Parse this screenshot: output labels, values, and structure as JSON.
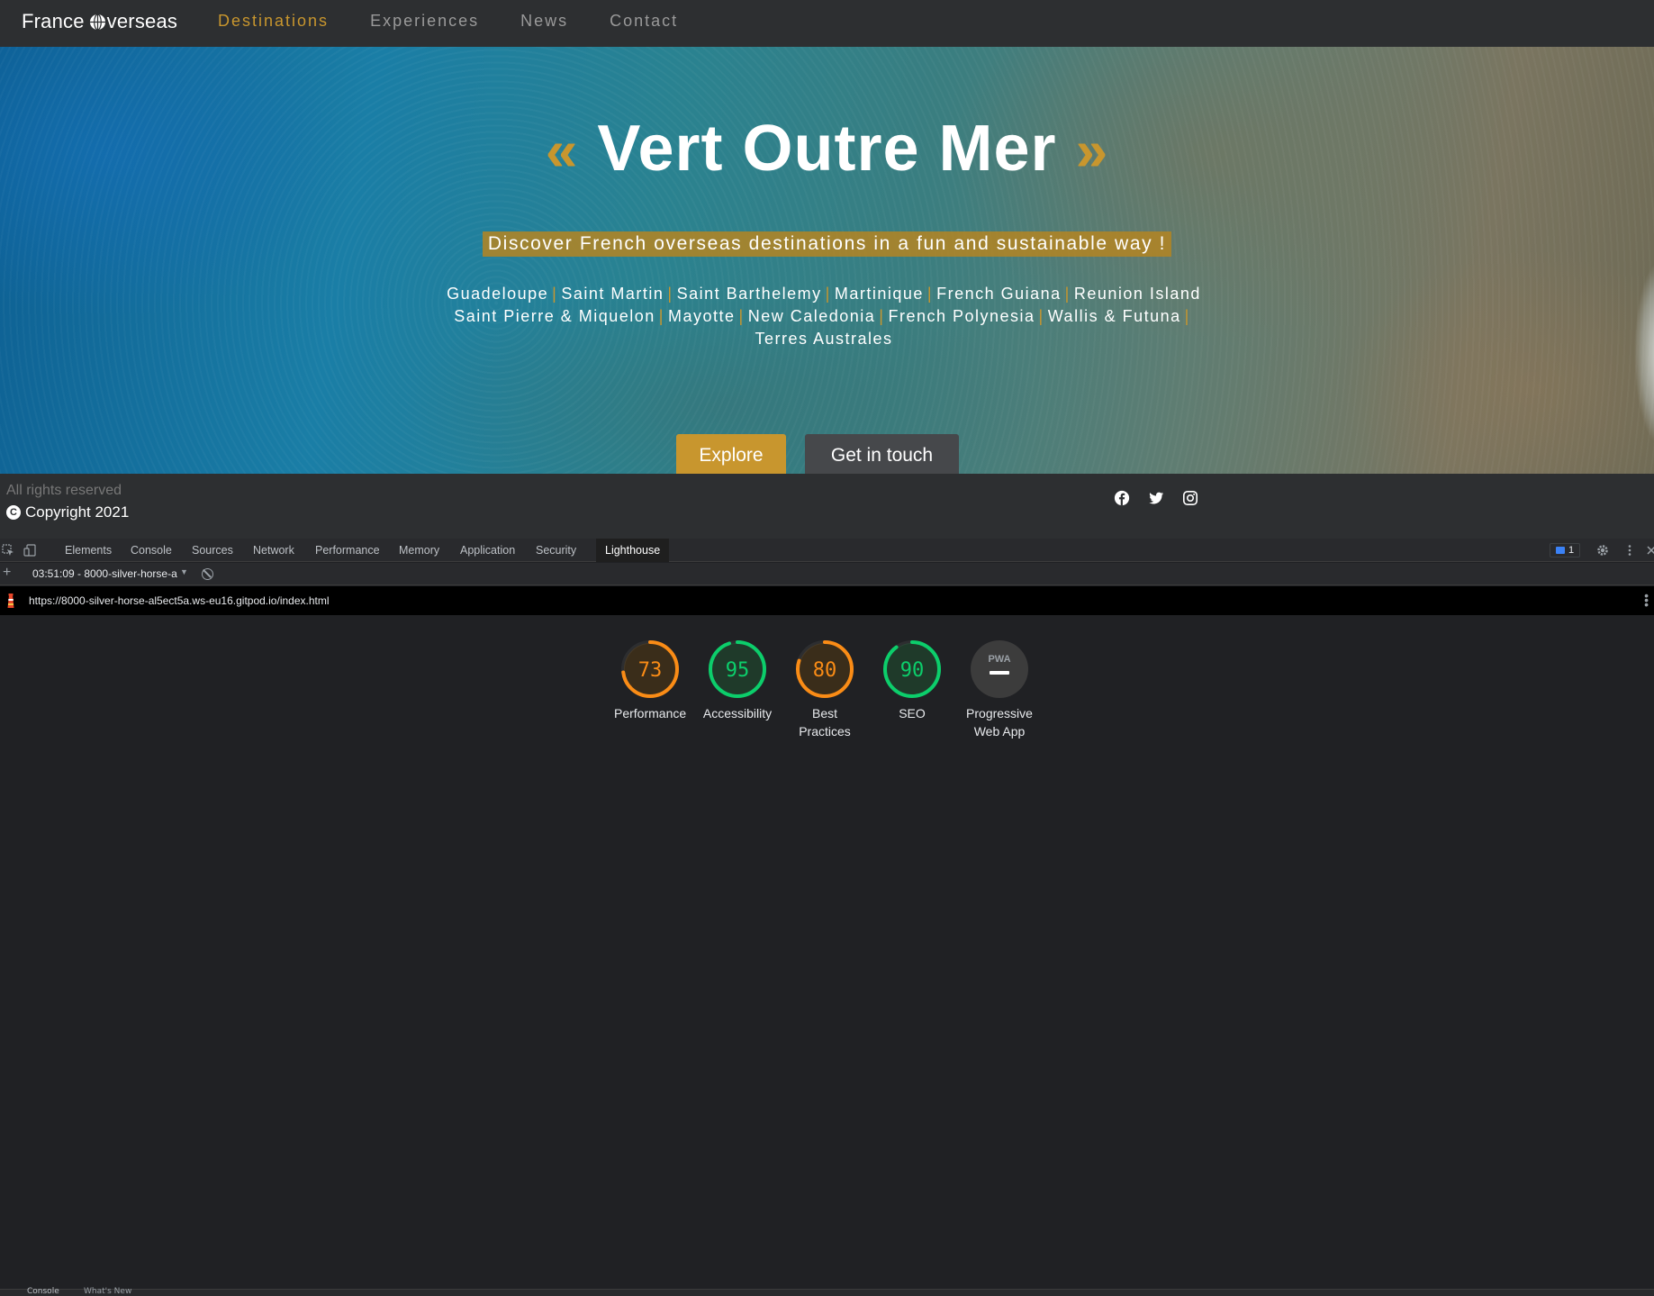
{
  "site": {
    "brand_prefix": "France ",
    "brand_suffix": "verseas",
    "nav": [
      "Destinations",
      "Experiences",
      "News",
      "Contact"
    ],
    "active_nav": "Destinations"
  },
  "hero": {
    "quote_open": "«",
    "title": "Vert Outre Mer",
    "quote_close": "»",
    "tagline": "Discover French overseas destinations in a fun and sustainable way !",
    "destinations": [
      "Guadeloupe",
      "Saint Martin",
      "Saint Barthelemy",
      "Martinique",
      "French Guiana",
      "Reunion Island",
      "Saint Pierre & Miquelon",
      "Mayotte",
      "New Caledonia",
      "French Polynesia",
      "Wallis & Futuna",
      "Terres Australes"
    ],
    "explore_label": "Explore",
    "contact_label": "Get in touch"
  },
  "footer": {
    "rights": "All rights reserved",
    "copyright": "Copyright 2021",
    "socials": [
      "facebook-icon",
      "twitter-icon",
      "instagram-icon"
    ]
  },
  "devtools": {
    "tabs": [
      "Elements",
      "Console",
      "Sources",
      "Network",
      "Performance",
      "Memory",
      "Application",
      "Security",
      "Lighthouse"
    ],
    "active_tab": "Lighthouse",
    "issues_count": "1",
    "report_label": "03:51:09 - 8000-silver-horse-a",
    "url": "https://8000-silver-horse-al5ect5a.ws-eu16.gitpod.io/index.html",
    "scores": [
      {
        "label": "Performance",
        "value": "73",
        "color": "#fa8c16"
      },
      {
        "label": "Accessibility",
        "value": "95",
        "color": "#0cce6b"
      },
      {
        "label": "Best Practices",
        "value": "80",
        "color": "#fa8c16"
      },
      {
        "label": "SEO",
        "value": "90",
        "color": "#0cce6b"
      },
      {
        "label": "Progressive Web App",
        "value": "PWA",
        "color": "#9aa0a6"
      }
    ],
    "drawer_tabs": [
      "Console",
      "What's New"
    ]
  }
}
